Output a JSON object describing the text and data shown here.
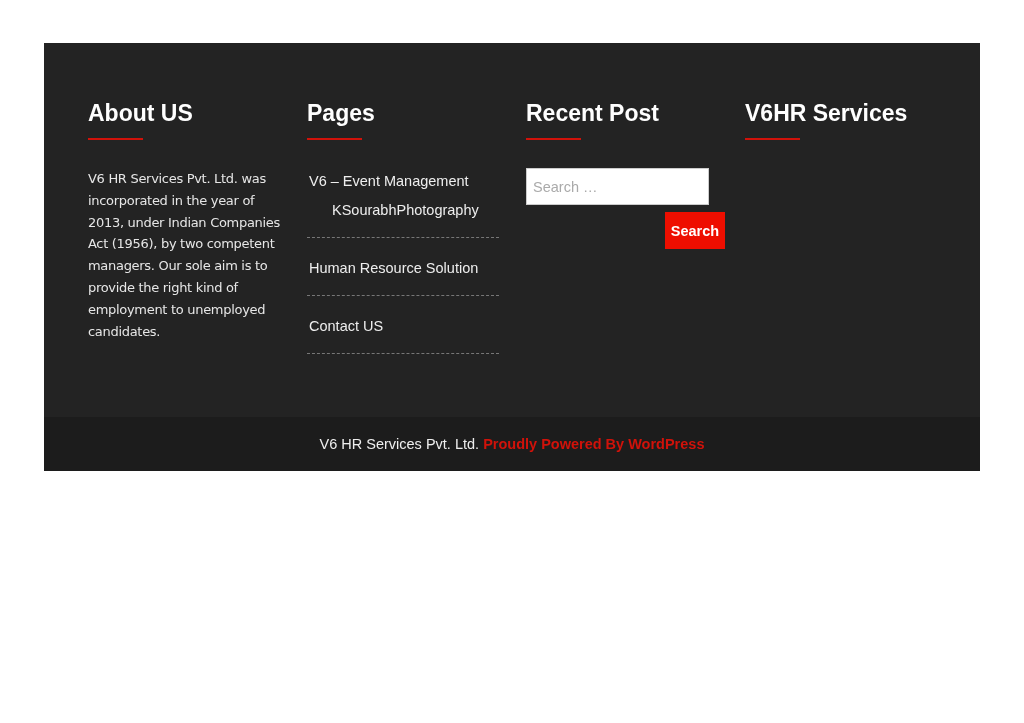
{
  "columns": [
    {
      "kind": "text",
      "title": "About US",
      "text": "V6 HR Services Pvt. Ltd. was incorporated in the year of 2013, under Indian Companies Act (1956), by two competent managers. Our sole aim is to provide the right kind of employment to unemployed candidates."
    },
    {
      "kind": "links",
      "title": "Pages",
      "items": [
        {
          "label": "V6 – Event Management",
          "children": [
            {
              "label": "KSourabhPhotography"
            }
          ]
        },
        {
          "label": "Human Resource Solution"
        },
        {
          "label": "Contact US"
        }
      ]
    },
    {
      "kind": "search",
      "title": "Recent Post",
      "search": {
        "placeholder": "Search …",
        "button": "Search"
      }
    },
    {
      "kind": "empty",
      "title": "V6HR Services"
    }
  ],
  "footer": {
    "text": "V6 HR Services Pvt. Ltd.",
    "link": "Proudly Powered By WordPress"
  }
}
